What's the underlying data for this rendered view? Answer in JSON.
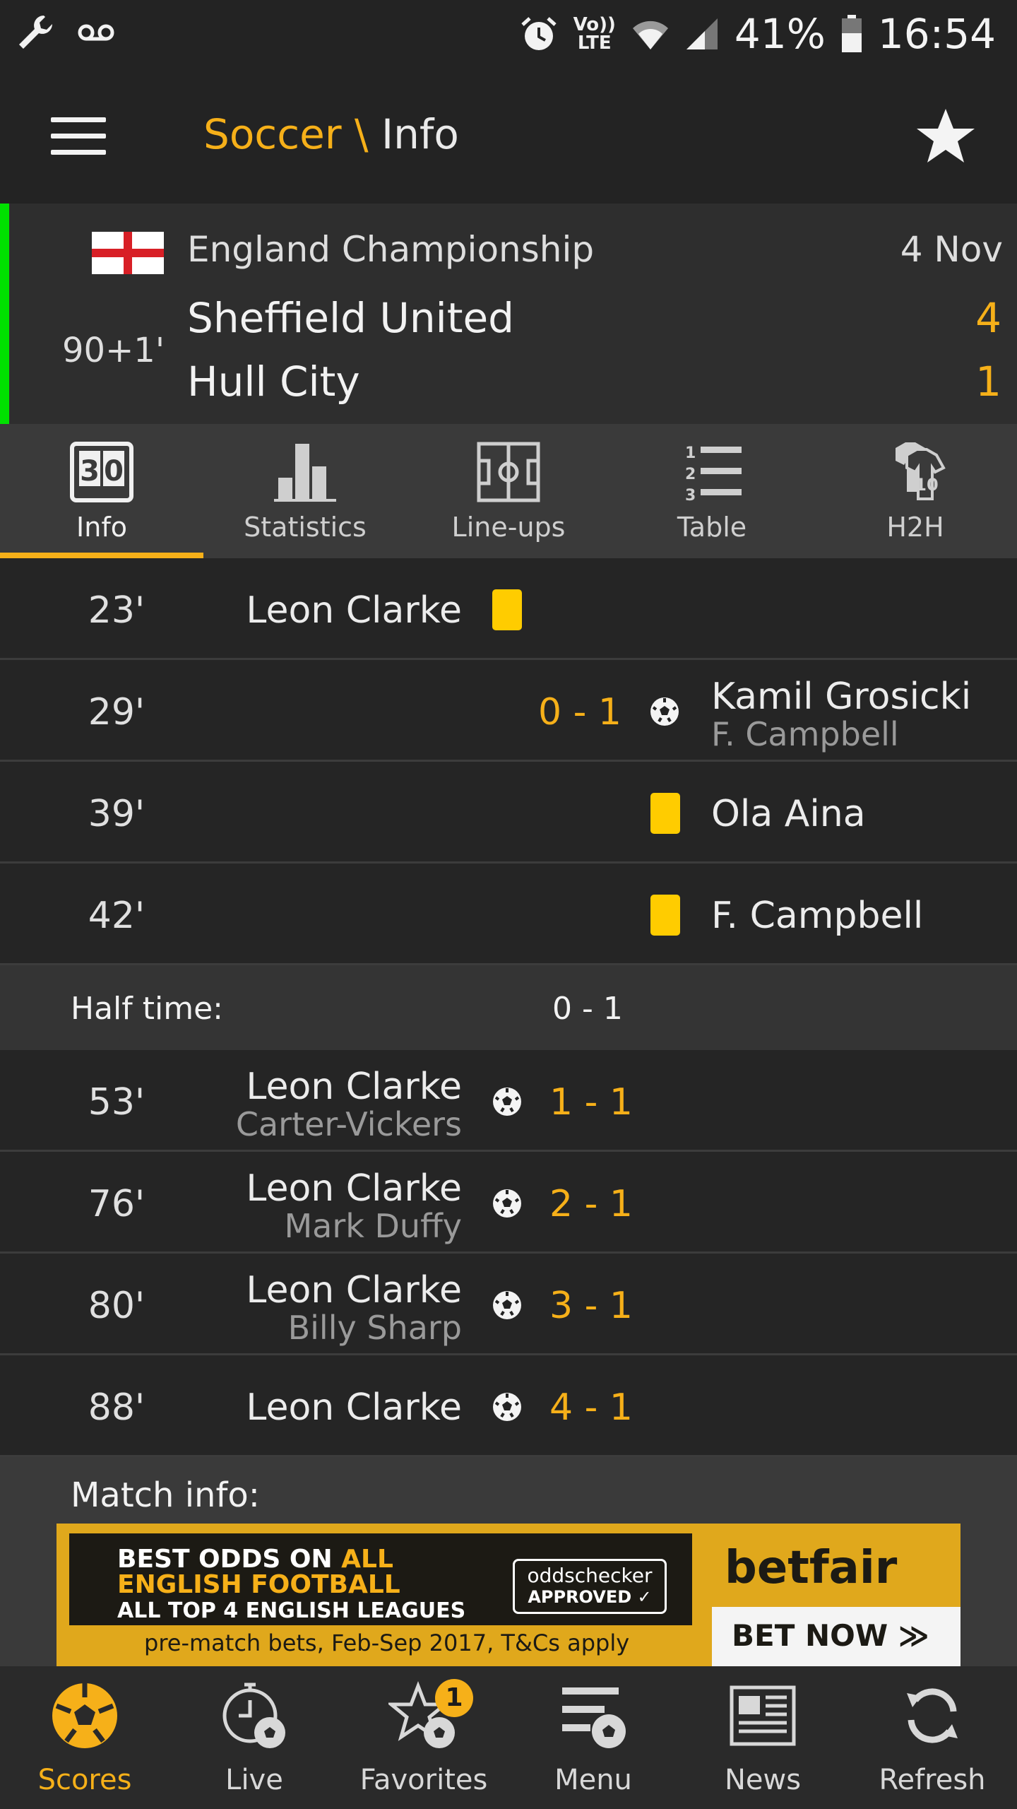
{
  "status_bar": {
    "battery": "41%",
    "time": "16:54",
    "network_label": "Vo)) LTE",
    "icons": [
      "wrench-icon",
      "voicemail-icon",
      "alarm-icon",
      "volte-icon",
      "wifi-icon",
      "signal-icon",
      "battery-icon"
    ]
  },
  "app_bar": {
    "section": "Soccer",
    "separator": " \\ ",
    "page": "Info",
    "accent_color": "#f6b019"
  },
  "match": {
    "league": "England Championship",
    "date": "4 Nov",
    "minute": "90+1'",
    "home_team": "Sheffield United",
    "home_score": "4",
    "away_team": "Hull City",
    "away_score": "1",
    "live_color": "#00e000"
  },
  "tabs": [
    {
      "label": "Info",
      "icon": "scoreboard-icon",
      "active": true
    },
    {
      "label": "Statistics",
      "icon": "bar-chart-icon",
      "active": false
    },
    {
      "label": "Line-ups",
      "icon": "pitch-icon",
      "active": false
    },
    {
      "label": "Table",
      "icon": "ranked-list-icon",
      "active": false
    },
    {
      "label": "H2H",
      "icon": "shirts-icon",
      "active": false
    }
  ],
  "events_first_half": [
    {
      "minute": "23'",
      "side": "home",
      "type": "yellow-card",
      "player": "Leon Clarke"
    },
    {
      "minute": "29'",
      "side": "away",
      "type": "goal",
      "player": "Kamil Grosicki",
      "assist": "F. Campbell",
      "score": "0 - 1"
    },
    {
      "minute": "39'",
      "side": "away",
      "type": "yellow-card",
      "player": "Ola Aina"
    },
    {
      "minute": "42'",
      "side": "away",
      "type": "yellow-card",
      "player": "F. Campbell"
    }
  ],
  "half_time": {
    "label": "Half time:",
    "score": "0 - 1"
  },
  "events_second_half": [
    {
      "minute": "53'",
      "side": "home",
      "type": "goal",
      "player": "Leon Clarke",
      "assist": "Carter-Vickers",
      "score": "1 - 1"
    },
    {
      "minute": "76'",
      "side": "home",
      "type": "goal",
      "player": "Leon Clarke",
      "assist": "Mark Duffy",
      "score": "2 - 1"
    },
    {
      "minute": "80'",
      "side": "home",
      "type": "goal",
      "player": "Leon Clarke",
      "assist": "Billy Sharp",
      "score": "3 - 1"
    },
    {
      "minute": "88'",
      "side": "home",
      "type": "goal",
      "player": "Leon Clarke",
      "score": "4 - 1"
    }
  ],
  "match_info": {
    "label": "Match info:",
    "ad": {
      "line1a": "BEST ODDS ON ",
      "line1b": "ALL",
      "line2": "ENGLISH FOOTBALL",
      "line3": "ALL TOP 4 ENGLISH LEAGUES",
      "badge_top": "oddschecker",
      "badge_bottom": "APPROVED ✓",
      "terms": "pre-match bets, Feb-Sep 2017, T&Cs apply",
      "brand": "betfair",
      "cta": "BET NOW ≫"
    }
  },
  "bottom_nav": [
    {
      "label": "Scores",
      "icon": "soccer-ball-icon",
      "active": true
    },
    {
      "label": "Live",
      "icon": "stopwatch-ball-icon",
      "active": false
    },
    {
      "label": "Favorites",
      "icon": "star-ball-icon",
      "active": false,
      "badge": "1"
    },
    {
      "label": "Menu",
      "icon": "menu-ball-icon",
      "active": false
    },
    {
      "label": "News",
      "icon": "newspaper-icon",
      "active": false
    },
    {
      "label": "Refresh",
      "icon": "refresh-icon",
      "active": false
    }
  ]
}
